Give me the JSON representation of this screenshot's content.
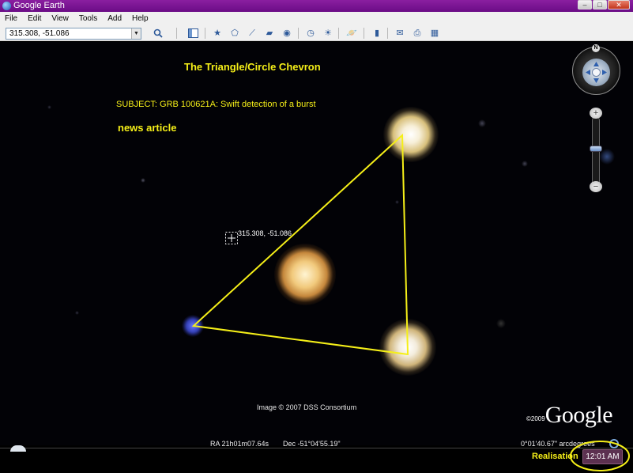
{
  "window": {
    "title": "Google Earth",
    "buttons": [
      "–",
      "□",
      "✕"
    ]
  },
  "menu": {
    "items": [
      "File",
      "Edit",
      "View",
      "Tools",
      "Add",
      "Help"
    ]
  },
  "toolbar": {
    "search_value": "315.308, -51.086",
    "search_icon": "magnifier-icon",
    "icons": [
      "sidebar-icon",
      "placemark-icon",
      "polygon-icon",
      "path-icon",
      "image-overlay-icon",
      "record-tour-icon",
      "historical-imagery-icon",
      "sunlight-icon",
      "planets-icon",
      "ruler-icon",
      "email-icon",
      "print-icon",
      "view-in-maps-icon"
    ]
  },
  "overlay": {
    "title": "The Triangle/Circle Chevron",
    "subject": "SUBJECT: GRB 100621A: Swift detection of a burst",
    "news": "news article",
    "coord_label": "315.308, -51.086",
    "copyright": "Image © 2007 DSS Consortium",
    "logo_copyright": "©2009",
    "logo_text": "Google",
    "annotation": "Realisation"
  },
  "navigation": {
    "north_label": "N",
    "zoom_plus": "+",
    "zoom_minus": "−",
    "zoom_level": 0.45
  },
  "status": {
    "ra": "RA  21h01m07.64s",
    "dec": "Dec  -51°04'55.19\"",
    "scale": "0°01'40.67\" arcdegrees",
    "time": "12:01 AM"
  },
  "colors": {
    "title_bar": "#7a1596",
    "annotation": "#f5ef18",
    "triangle": "#f5ef18"
  }
}
